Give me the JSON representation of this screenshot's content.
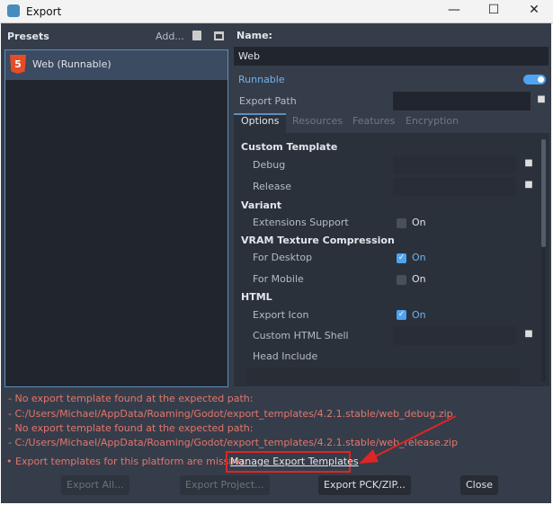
{
  "window": {
    "title": "Export",
    "minimize": "—",
    "maximize": "☐",
    "close": "✕"
  },
  "presets": {
    "title": "Presets",
    "add": "Add...",
    "items": [
      {
        "label": "Web (Runnable)",
        "icon": "html5-icon"
      }
    ]
  },
  "details": {
    "name_label": "Name:",
    "name_value": "Web",
    "runnable_label": "Runnable",
    "runnable_on": true,
    "export_path_label": "Export Path",
    "export_path_value": "",
    "tabs": [
      "Options",
      "Resources",
      "Features",
      "Encryption"
    ],
    "active_tab": "Options",
    "options": {
      "custom_template": "Custom Template",
      "debug": "Debug",
      "release": "Release",
      "variant": "Variant",
      "extensions_support": "Extensions Support",
      "extensions_value": "On",
      "vram": "VRAM Texture Compression",
      "for_desktop": "For Desktop",
      "for_desktop_value": "On",
      "for_mobile": "For Mobile",
      "for_mobile_value": "On",
      "html": "HTML",
      "export_icon": "Export Icon",
      "export_icon_value": "On",
      "custom_html_shell": "Custom HTML Shell",
      "head_include": "Head Include"
    }
  },
  "errors": [
    "- No export template found at the expected path:",
    "- C:/Users/Michael/AppData/Roaming/Godot/export_templates/4.2.1.stable/web_debug.zip",
    "- No export template found at the expected path:",
    "- C:/Users/Michael/AppData/Roaming/Godot/export_templates/4.2.1.stable/web_release.zip"
  ],
  "missing": {
    "bullet": "•",
    "text": "Export templates for this platform are missing:",
    "link": "Manage Export Templates"
  },
  "buttons": {
    "export_all": "Export All...",
    "export_project": "Export Project...",
    "export_pck": "Export PCK/ZIP...",
    "close": "Close"
  },
  "colors": {
    "accent": "#4fa3f0",
    "error": "#e3766c",
    "annotation": "#e02424"
  }
}
